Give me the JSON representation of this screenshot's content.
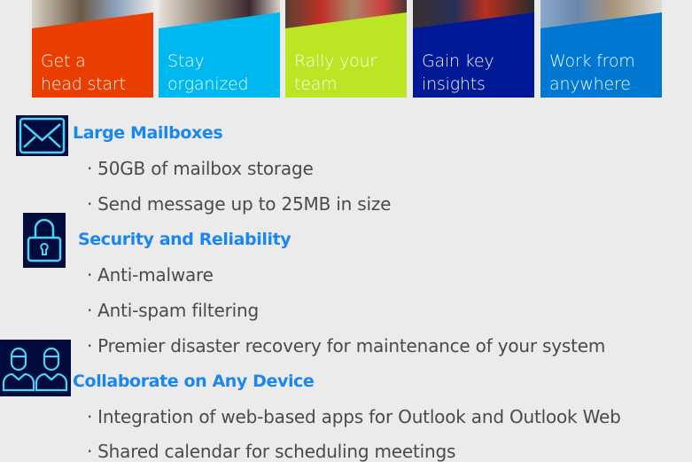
{
  "tiles": [
    {
      "label": "Get a\nhead start",
      "color": "#ea3e00",
      "photo": "#6b5a48"
    },
    {
      "label": "Stay\norganized",
      "color": "#00b8f0",
      "photo": "#8a7c70"
    },
    {
      "label": "Rally your\nteam",
      "color": "#bce623",
      "photo": "#5a4032"
    },
    {
      "label": "Gain key\ninsights",
      "color": "#001996",
      "photo": "#3a3030"
    },
    {
      "label": "Work from\nanywhere",
      "color": "#0078d2",
      "photo": "#a89478"
    }
  ],
  "sections": [
    {
      "icon": "envelope-icon",
      "title": "Large Mailboxes",
      "bullets": [
        "50GB of mailbox storage",
        "Send message up to 25MB in size"
      ]
    },
    {
      "icon": "lock-icon",
      "title": "Security and Reliability",
      "bullets": [
        "Anti-malware",
        "Anti-spam filtering",
        "Premier disaster recovery for maintenance of your system"
      ]
    },
    {
      "icon": "users-icon",
      "title": "Collaborate on Any Device",
      "bullets": [
        "Integration of web-based apps for Outlook and Outlook Web",
        "Shared calendar for scheduling meetings"
      ]
    }
  ],
  "bullet_char": "·",
  "colors": {
    "heading": "#1a86f0",
    "icon_bg": "#010c3d",
    "icon_stroke": "#4fd0f5",
    "body_text": "#4a4a4a"
  }
}
